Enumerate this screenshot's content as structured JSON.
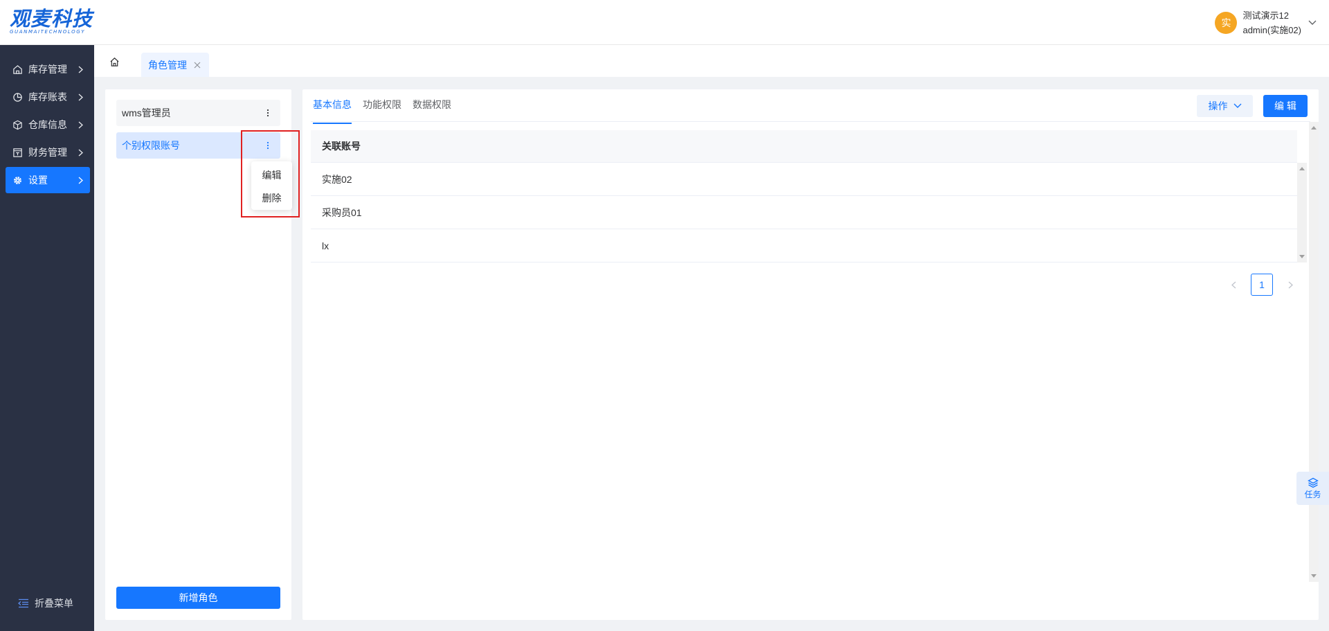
{
  "header": {
    "logo_main": "观麦科技",
    "logo_sub": "GUANMAITECHNOLOGY",
    "avatar_text": "实",
    "user_name": "测试演示12",
    "user_account": "admin(实施02)"
  },
  "sidebar": {
    "items": [
      {
        "label": "库存管理",
        "icon": "warehouse-icon"
      },
      {
        "label": "库存账表",
        "icon": "pie-chart-icon"
      },
      {
        "label": "仓库信息",
        "icon": "cube-icon"
      },
      {
        "label": "财务管理",
        "icon": "finance-icon"
      },
      {
        "label": "设置",
        "icon": "gear-icon",
        "active": true
      }
    ],
    "collapse_label": "折叠菜单"
  },
  "tabbar": {
    "tabs": [
      {
        "label": "角色管理",
        "active": true
      }
    ]
  },
  "roles": {
    "items": [
      {
        "label": "wms管理员"
      },
      {
        "label": "个别权限账号",
        "selected": true
      }
    ],
    "menu": [
      "编辑",
      "删除"
    ],
    "add_label": "新增角色"
  },
  "detail": {
    "tabs": [
      "基本信息",
      "功能权限",
      "数据权限"
    ],
    "active_tab": "基本信息",
    "ops_label": "操作",
    "edit_label": "编 辑",
    "table": {
      "header": "关联账号",
      "rows": [
        "实施02",
        "采购员01",
        "lx"
      ]
    },
    "pagination": {
      "current": "1"
    }
  },
  "float": {
    "task_label": "任务"
  },
  "colors": {
    "primary": "#1677ff",
    "sidebar_bg": "#2a3144",
    "highlight_box": "#e02020",
    "avatar": "#f5a623"
  }
}
